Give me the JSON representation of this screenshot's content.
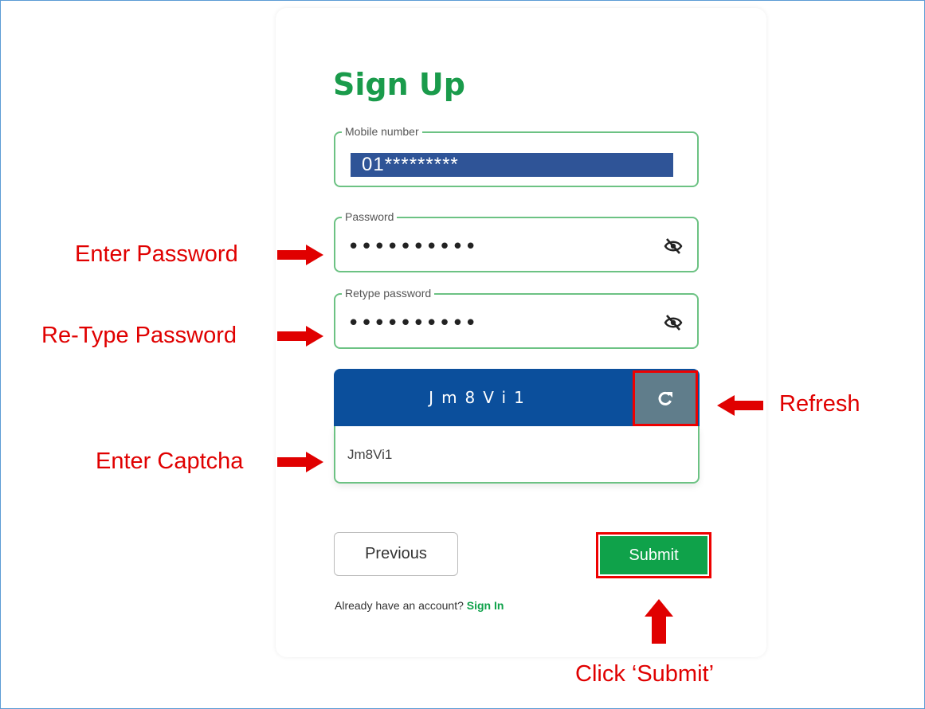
{
  "form": {
    "title": "Sign Up",
    "mobile": {
      "label": "Mobile number",
      "value": "01*********"
    },
    "password": {
      "label": "Password",
      "value": "••••••••••"
    },
    "retype": {
      "label": "Retype password",
      "value": "••••••••••"
    },
    "captcha": {
      "text": "Jm8Vi1",
      "input_value": "Jm8Vi1"
    },
    "previous_label": "Previous",
    "submit_label": "Submit",
    "account_prompt": "Already have an account?",
    "signin_label": "Sign In"
  },
  "annotations": {
    "enter_password": "Enter Password",
    "retype_password": "Re-Type Password",
    "enter_captcha": "Enter Captcha",
    "refresh": "Refresh",
    "click_submit": "Click ‘Submit’"
  },
  "icons": {
    "eye": "eye-slash-icon",
    "refresh": "refresh-icon",
    "arrow_right": "arrow-right-icon",
    "arrow_left": "arrow-left-icon",
    "arrow_up": "arrow-up-icon"
  },
  "colors": {
    "brand_green": "#1a9b4b",
    "captcha_blue": "#0b4f9c",
    "refresh_gray": "#607d8b",
    "annotation_red": "#e00000"
  }
}
